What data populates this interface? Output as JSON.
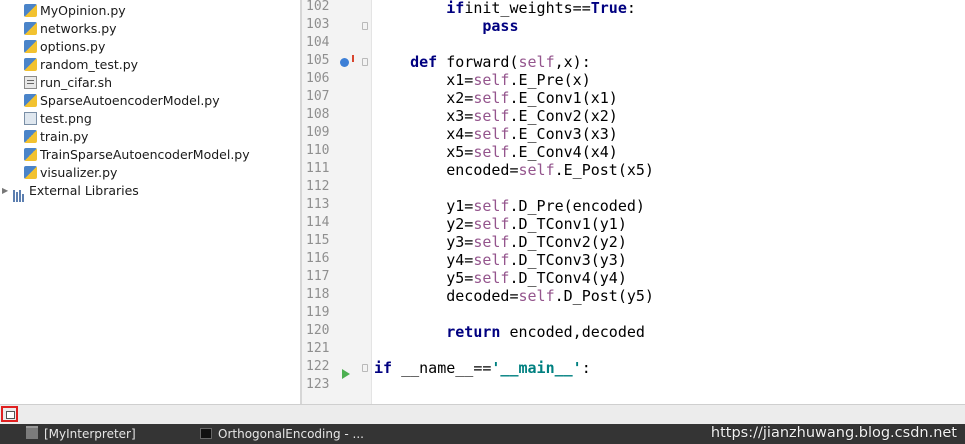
{
  "project_tree": {
    "items": [
      {
        "label": "MyOpinion.py",
        "icon": "python-file-icon"
      },
      {
        "label": "networks.py",
        "icon": "python-file-icon"
      },
      {
        "label": "options.py",
        "icon": "python-file-icon"
      },
      {
        "label": "random_test.py",
        "icon": "python-file-icon"
      },
      {
        "label": "run_cifar.sh",
        "icon": "shell-file-icon"
      },
      {
        "label": "SparseAutoencoderModel.py",
        "icon": "python-file-icon"
      },
      {
        "label": "test.png",
        "icon": "image-file-icon"
      },
      {
        "label": "train.py",
        "icon": "python-file-icon"
      },
      {
        "label": "TrainSparseAutoencoderModel.py",
        "icon": "python-file-icon"
      },
      {
        "label": "visualizer.py",
        "icon": "python-file-icon"
      },
      {
        "label": "External Libraries",
        "icon": "library-icon"
      }
    ]
  },
  "editor": {
    "line_numbers": [
      "102",
      "103",
      "104",
      "105",
      "106",
      "107",
      "108",
      "109",
      "110",
      "111",
      "112",
      "113",
      "114",
      "115",
      "116",
      "117",
      "118",
      "119",
      "120",
      "121",
      "122",
      "123"
    ],
    "lines": [
      {
        "indent": "        ",
        "tokens": [
          [
            "kw",
            "if"
          ],
          [
            "",
            "init_weights=="
          ],
          [
            "kw",
            "True"
          ],
          [
            "",
            ":"
          ]
        ]
      },
      {
        "indent": "            ",
        "tokens": [
          [
            "kw",
            "pass"
          ]
        ]
      },
      {
        "indent": "",
        "tokens": []
      },
      {
        "indent": "    ",
        "tokens": [
          [
            "kw",
            "def"
          ],
          [
            "",
            " forward("
          ],
          [
            "slf",
            "self"
          ],
          [
            "",
            ",x):"
          ]
        ]
      },
      {
        "indent": "        ",
        "tokens": [
          [
            "",
            "x1="
          ],
          [
            "slf",
            "self"
          ],
          [
            "",
            ".E_Pre(x)"
          ]
        ]
      },
      {
        "indent": "        ",
        "tokens": [
          [
            "",
            "x2="
          ],
          [
            "slf",
            "self"
          ],
          [
            "",
            ".E_Conv1(x1)"
          ]
        ]
      },
      {
        "indent": "        ",
        "tokens": [
          [
            "",
            "x3="
          ],
          [
            "slf",
            "self"
          ],
          [
            "",
            ".E_Conv2(x2)"
          ]
        ]
      },
      {
        "indent": "        ",
        "tokens": [
          [
            "",
            "x4="
          ],
          [
            "slf",
            "self"
          ],
          [
            "",
            ".E_Conv3(x3)"
          ]
        ]
      },
      {
        "indent": "        ",
        "tokens": [
          [
            "",
            "x5="
          ],
          [
            "slf",
            "self"
          ],
          [
            "",
            ".E_Conv4(x4)"
          ]
        ]
      },
      {
        "indent": "        ",
        "tokens": [
          [
            "",
            "encoded="
          ],
          [
            "slf",
            "self"
          ],
          [
            "",
            ".E_Post(x5)"
          ]
        ]
      },
      {
        "indent": "",
        "tokens": []
      },
      {
        "indent": "        ",
        "tokens": [
          [
            "",
            "y1="
          ],
          [
            "slf",
            "self"
          ],
          [
            "",
            ".D_Pre(encoded)"
          ]
        ]
      },
      {
        "indent": "        ",
        "tokens": [
          [
            "",
            "y2="
          ],
          [
            "slf",
            "self"
          ],
          [
            "",
            ".D_TConv1(y1)"
          ]
        ]
      },
      {
        "indent": "        ",
        "tokens": [
          [
            "",
            "y3="
          ],
          [
            "slf",
            "self"
          ],
          [
            "",
            ".D_TConv2(y2)"
          ]
        ]
      },
      {
        "indent": "        ",
        "tokens": [
          [
            "",
            "y4="
          ],
          [
            "slf",
            "self"
          ],
          [
            "",
            ".D_TConv3(y3)"
          ]
        ]
      },
      {
        "indent": "        ",
        "tokens": [
          [
            "",
            "y5="
          ],
          [
            "slf",
            "self"
          ],
          [
            "",
            ".D_TConv4(y4)"
          ]
        ]
      },
      {
        "indent": "        ",
        "tokens": [
          [
            "",
            "decoded="
          ],
          [
            "slf",
            "self"
          ],
          [
            "",
            ".D_Post(y5)"
          ]
        ]
      },
      {
        "indent": "",
        "tokens": []
      },
      {
        "indent": "        ",
        "tokens": [
          [
            "kw",
            "return"
          ],
          [
            "",
            " encoded,decoded"
          ]
        ]
      },
      {
        "indent": "",
        "tokens": []
      },
      {
        "indent": "",
        "tokens": [
          [
            "kw",
            "if"
          ],
          [
            "",
            " __name__=="
          ],
          [
            "str",
            "'__main__'"
          ],
          [
            "",
            ":"
          ]
        ]
      },
      {
        "indent": "",
        "tokens": []
      }
    ],
    "gutter_icons": [
      "override-method-icon",
      "run-gutter-icon"
    ]
  },
  "taskbar": {
    "items": [
      {
        "label": "[MyInterpreter]",
        "icon": "folder-icon"
      },
      {
        "label": "OrthogonalEncoding - ...",
        "icon": "pycharm-icon"
      }
    ],
    "watermark": "https://jianzhuwang.blog.csdn.net"
  },
  "colors": {
    "keyword": "#000080",
    "self": "#94558d",
    "string": "#008080",
    "highlight_box": "#e02020"
  }
}
